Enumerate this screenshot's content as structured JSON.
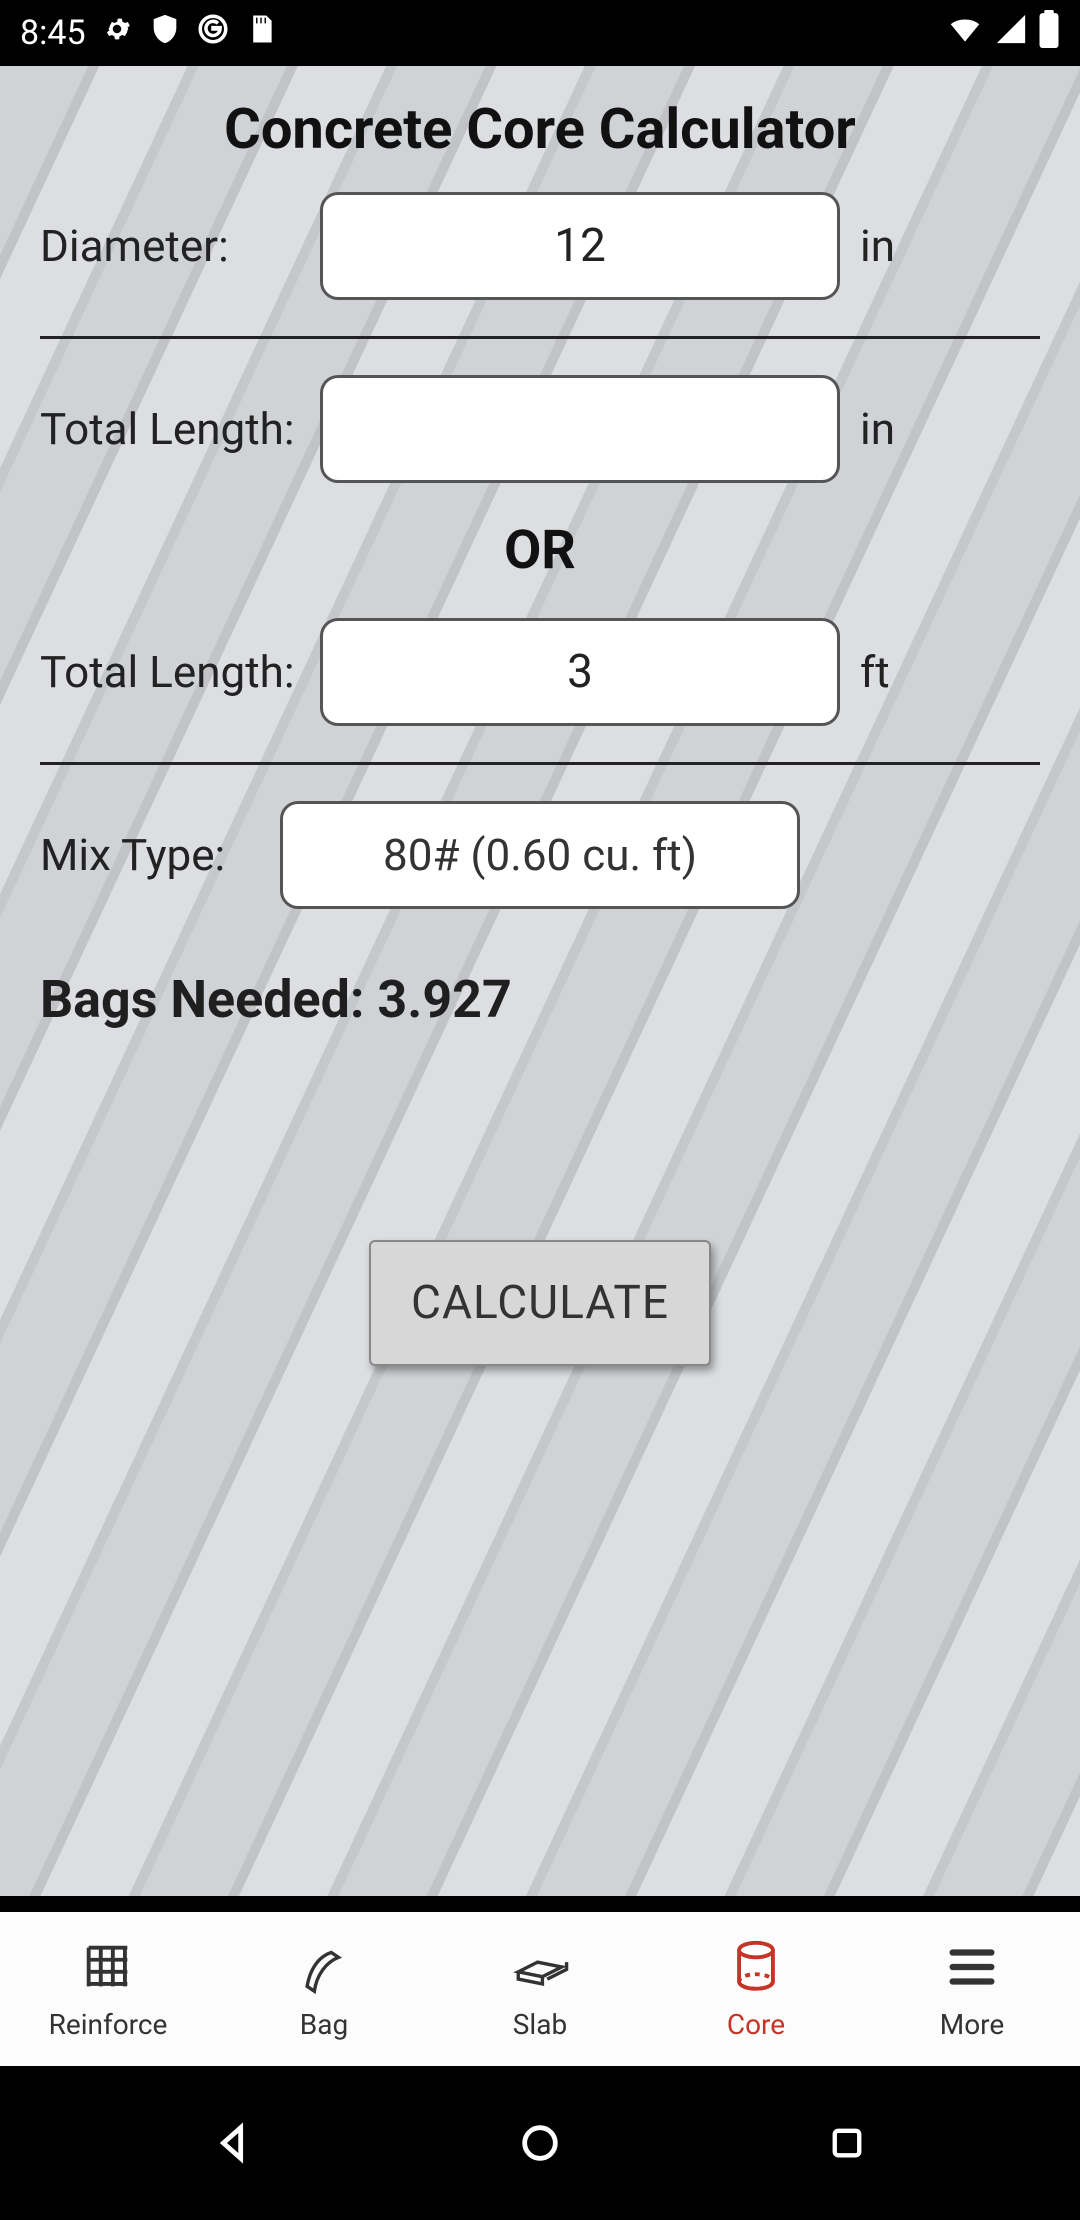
{
  "status": {
    "time": "8:45",
    "icons_left": [
      "gear-icon",
      "shield-icon",
      "g-icon",
      "sd-icon"
    ],
    "icons_right": [
      "wifi-icon",
      "signal-icon",
      "battery-icon"
    ]
  },
  "title": "Concrete Core Calculator",
  "diameter": {
    "label": "Diameter:",
    "value": "12",
    "unit": "in"
  },
  "length_in": {
    "label": "Total Length:",
    "value": "",
    "unit": "in"
  },
  "or_label": "OR",
  "length_ft": {
    "label": "Total Length:",
    "value": "3",
    "unit": "ft"
  },
  "mix": {
    "label": "Mix Type:",
    "value": "80# (0.60 cu. ft)"
  },
  "result": {
    "prefix": "Bags Needed: ",
    "value": "3.927"
  },
  "calculate_label": "CALCULATE",
  "nav": {
    "items": [
      {
        "label": "Reinforce",
        "icon": "grid-icon"
      },
      {
        "label": "Bag",
        "icon": "bag-icon"
      },
      {
        "label": "Slab",
        "icon": "slab-icon"
      },
      {
        "label": "Core",
        "icon": "cylinder-icon",
        "active": true
      },
      {
        "label": "More",
        "icon": "more-icon"
      }
    ]
  }
}
